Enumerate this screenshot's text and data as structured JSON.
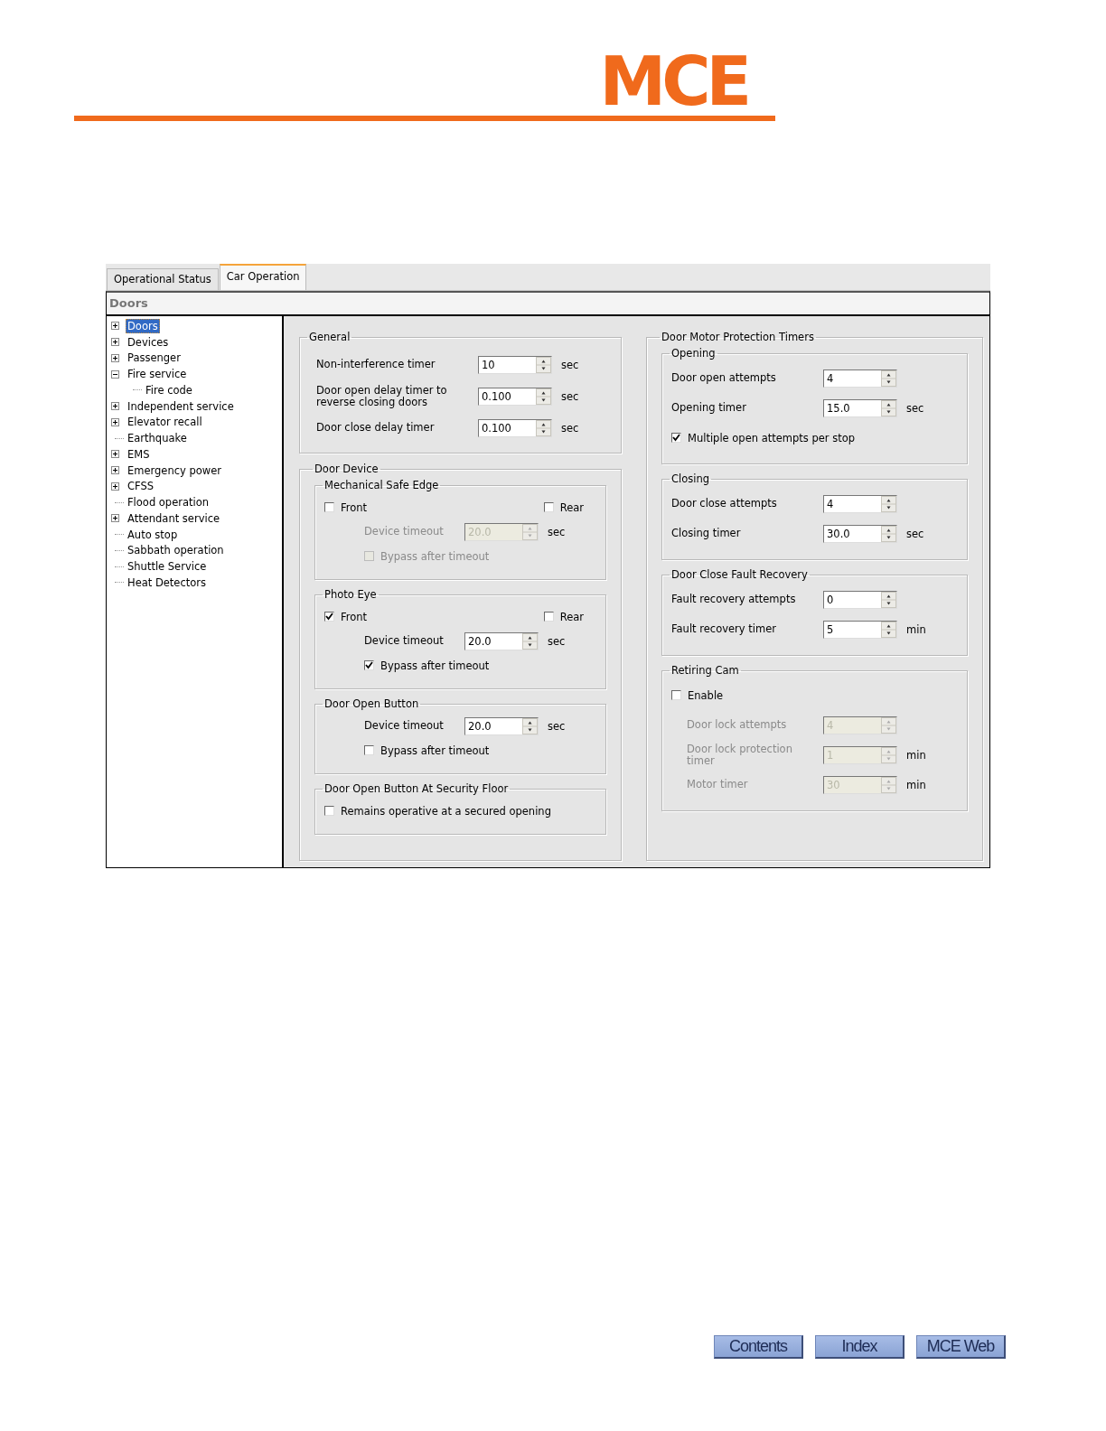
{
  "logo": {
    "text": "MCE"
  },
  "tabs": [
    {
      "label": "Operational Status",
      "selected": false
    },
    {
      "label": "Car Operation",
      "selected": true
    }
  ],
  "section_title": "Doors",
  "tree": [
    {
      "label": "Doors",
      "kind": "folder",
      "expanded": false,
      "selected": true
    },
    {
      "label": "Devices",
      "kind": "folder",
      "expanded": false,
      "selected": false
    },
    {
      "label": "Passenger",
      "kind": "folder",
      "expanded": false,
      "selected": false
    },
    {
      "label": "Fire service",
      "kind": "folder",
      "expanded": true,
      "selected": false,
      "children": [
        {
          "label": "Fire code",
          "kind": "leaf",
          "selected": false
        }
      ]
    },
    {
      "label": "Independent service",
      "kind": "folder",
      "expanded": false,
      "selected": false
    },
    {
      "label": "Elevator recall",
      "kind": "folder",
      "expanded": false,
      "selected": false
    },
    {
      "label": "Earthquake",
      "kind": "leaf",
      "selected": false
    },
    {
      "label": "EMS",
      "kind": "folder",
      "expanded": false,
      "selected": false
    },
    {
      "label": "Emergency power",
      "kind": "folder",
      "expanded": false,
      "selected": false
    },
    {
      "label": "CFSS",
      "kind": "folder",
      "expanded": false,
      "selected": false
    },
    {
      "label": "Flood operation",
      "kind": "leaf",
      "selected": false
    },
    {
      "label": "Attendant service",
      "kind": "folder",
      "expanded": false,
      "selected": false
    },
    {
      "label": "Auto stop",
      "kind": "leaf",
      "selected": false
    },
    {
      "label": "Sabbath operation",
      "kind": "leaf",
      "selected": false
    },
    {
      "label": "Shuttle Service",
      "kind": "leaf",
      "selected": false
    },
    {
      "label": "Heat Detectors",
      "kind": "leaf",
      "selected": false
    }
  ],
  "columns": [
    [
      {
        "title": "General",
        "rows": [
          {
            "kind": "spin",
            "label": "Non-interference timer",
            "value": "10",
            "unit": "sec",
            "disabled": false
          },
          {
            "kind": "spin",
            "label": "Door open delay timer to reverse closing doors",
            "value": "0.100",
            "unit": "sec",
            "disabled": false
          },
          {
            "kind": "spin",
            "label": "Door close delay timer",
            "value": "0.100",
            "unit": "sec",
            "disabled": false
          }
        ]
      },
      {
        "title": "Door Device",
        "groups": [
          {
            "title": "Mechanical Safe Edge",
            "rows": [
              {
                "kind": "check_pair",
                "items": [
                  {
                    "label": "Front",
                    "checked": false
                  },
                  {
                    "label": "Rear",
                    "checked": false
                  }
                ]
              },
              {
                "kind": "sub_spin",
                "label": "Device timeout",
                "value": "20.0",
                "unit": "sec",
                "disabled": true
              },
              {
                "kind": "sub_check",
                "label": "Bypass after timeout",
                "checked": false,
                "disabled": true
              }
            ]
          },
          {
            "title": "Photo Eye",
            "rows": [
              {
                "kind": "check_pair",
                "items": [
                  {
                    "label": "Front",
                    "checked": true
                  },
                  {
                    "label": "Rear",
                    "checked": false
                  }
                ]
              },
              {
                "kind": "sub_spin",
                "label": "Device timeout",
                "value": "20.0",
                "unit": "sec",
                "disabled": false
              },
              {
                "kind": "sub_check",
                "label": "Bypass after timeout",
                "checked": true,
                "disabled": false
              }
            ]
          },
          {
            "title": "Door Open Button",
            "rows": [
              {
                "kind": "sub_spin",
                "label": "Device timeout",
                "value": "20.0",
                "unit": "sec",
                "disabled": false
              },
              {
                "kind": "sub_check",
                "label": "Bypass after timeout",
                "checked": false,
                "disabled": false
              }
            ]
          },
          {
            "title": "Door Open Button At Security Floor",
            "rows": [
              {
                "kind": "check",
                "label": "Remains operative at a secured opening",
                "checked": false,
                "disabled": false
              }
            ]
          }
        ]
      }
    ],
    [
      {
        "title": "Door Motor Protection Timers",
        "groups": [
          {
            "title": "Opening",
            "rows": [
              {
                "kind": "spin",
                "label": "Door open attempts",
                "value": "4",
                "disabled": false
              },
              {
                "kind": "spin",
                "label": "Opening timer",
                "value": "15.0",
                "unit": "sec",
                "disabled": false
              },
              {
                "kind": "check",
                "label": "Multiple open attempts per stop",
                "checked": true,
                "disabled": false
              }
            ]
          },
          {
            "title": "Closing",
            "rows": [
              {
                "kind": "spin",
                "label": "Door close attempts",
                "value": "4",
                "disabled": false
              },
              {
                "kind": "spin",
                "label": "Closing timer",
                "value": "30.0",
                "unit": "sec",
                "disabled": false
              }
            ]
          },
          {
            "title": "Door Close Fault Recovery",
            "rows": [
              {
                "kind": "spin",
                "label": "Fault recovery attempts",
                "value": "0",
                "disabled": false
              },
              {
                "kind": "spin",
                "label": "Fault recovery timer",
                "value": "5",
                "unit": "min",
                "disabled": false
              }
            ]
          },
          {
            "title": "Retiring Cam",
            "rows": [
              {
                "kind": "check",
                "label": "Enable",
                "checked": false,
                "disabled": false
              },
              {
                "kind": "sub_spin",
                "label": "Door lock attempts",
                "value": "4",
                "disabled": true
              },
              {
                "kind": "sub_spin",
                "label": "Door lock protection timer",
                "value": "1",
                "unit": "min",
                "disabled": true
              },
              {
                "kind": "sub_spin",
                "label": "Motor timer",
                "value": "30",
                "unit": "min",
                "disabled": true
              }
            ]
          }
        ]
      }
    ]
  ],
  "footer_buttons": [
    "Contents",
    "Index",
    "MCE Web"
  ]
}
